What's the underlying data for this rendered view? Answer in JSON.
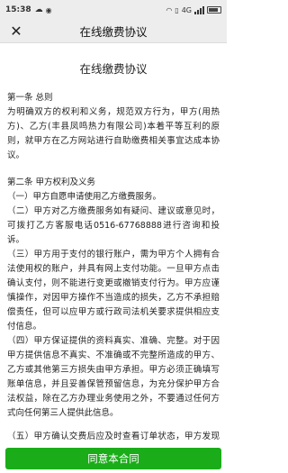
{
  "status_bar": {
    "time": "15:38",
    "network": "4G",
    "colors": {
      "background": "#ededed"
    }
  },
  "nav": {
    "close_icon": "close-icon",
    "title": "在线缴费协议"
  },
  "document": {
    "title": "在线缴费协议",
    "sections": [
      {
        "heading": "第一条  总则",
        "paragraphs": [
          "为明确双方的权利和义务，规范双方行为，甲方(用热方)、乙方(丰县凤鸣热力有限公司)本着平等互利的原则，就甲方在乙方网站进行自助缴费相关事宜达成本协议。"
        ]
      },
      {
        "heading": "第二条  甲方权利及义务",
        "paragraphs": [
          "（一）甲方自愿申请使用乙方缴费服务。",
          "（二）甲方对乙方缴费服务如有疑问、建议或意见时，可拨打乙方客服电话0516-67768888进行咨询和投诉。",
          "（三）甲方用于支付的银行账户，需为甲方个人拥有合法使用权的账户，并具有网上支付功能。一旦甲方点击确认支付，则不能进行变更或撤销支付行为。甲方应谨慎操作，对因甲方操作不当造成的损失，乙方不承担赔偿责任，但可以应甲方或行政司法机关要求提供相应支付信息。",
          "（四）甲方保证提供的资料真实、准确、完整。对于因甲方提供信息不真实、不准确或不完整所造成的甲方、乙方或其他第三方损失由甲方承担。甲方必须正确填写账单信息，并且妥善保管预留信息，为充分保护甲方合法权益，除在乙方办理业务使用之外，不要通过任何方式向任何第三人提供此信息。",
          "（五）甲方确认交费后应及时查看订单状态，甲方发现缴费指令未执行、未适当执行、延迟执行的，应及时通"
        ]
      }
    ]
  },
  "footer": {
    "agree_label": "同意本合同",
    "colors": {
      "button": "#1aad19",
      "text": "#ffffff"
    }
  }
}
